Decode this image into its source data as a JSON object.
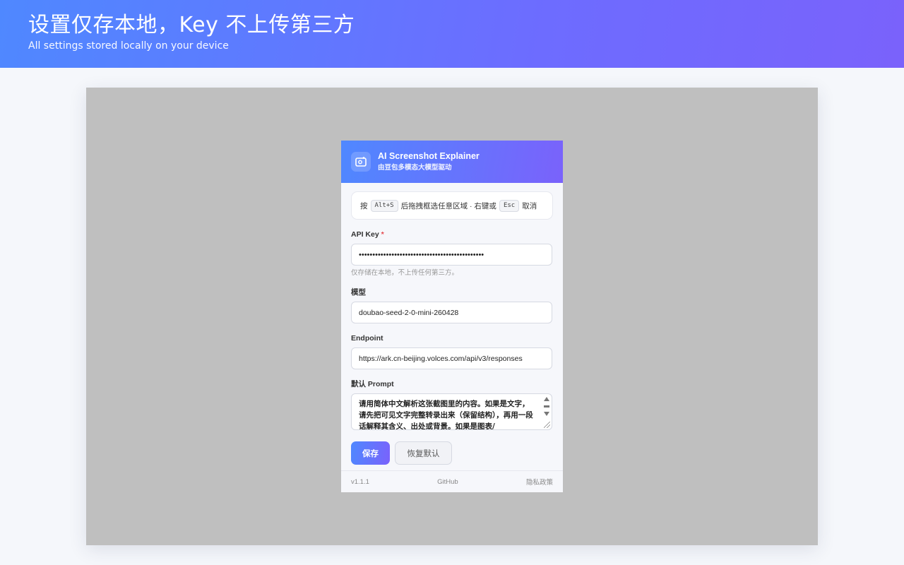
{
  "banner": {
    "title": "设置仅存本地，Key 不上传第三方",
    "subtitle": "All settings stored locally on your device"
  },
  "popup": {
    "app_name": "AI Screenshot Explainer",
    "tagline": "由豆包多模态大模型驱动",
    "logo_icon": "screenshot-camera-icon",
    "hint": {
      "prefix": "按",
      "shortcut": "Alt+S",
      "middle": "后拖拽框选任意区域 · 右键或",
      "cancel_key": "Esc",
      "suffix": "取消"
    },
    "api_key": {
      "label": "API Key",
      "required_mark": "*",
      "value": "••••••••••••••••••••••••••••••••••••••••••••••",
      "help": "仅存储在本地，不上传任何第三方。"
    },
    "model": {
      "label": "模型",
      "value": "doubao-seed-2-0-mini-260428"
    },
    "endpoint": {
      "label": "Endpoint",
      "value": "https://ark.cn-beijing.volces.com/api/v3/responses"
    },
    "prompt": {
      "label": "默认 Prompt",
      "value": "请用简体中文解析这张截图里的内容。如果是文字，请先把可见文字完整转录出来（保留结构），再用一段话解释其含义、出处或背景。如果是图表/"
    },
    "buttons": {
      "save": "保存",
      "reset": "恢复默认"
    },
    "footer": {
      "version": "v1.1.1",
      "github": "GitHub",
      "privacy": "隐私政策"
    }
  },
  "colors": {
    "accent_start": "#4f88ff",
    "accent_end": "#7a62fb",
    "stage_bg": "#bfbfbf",
    "required": "#e5484d"
  }
}
